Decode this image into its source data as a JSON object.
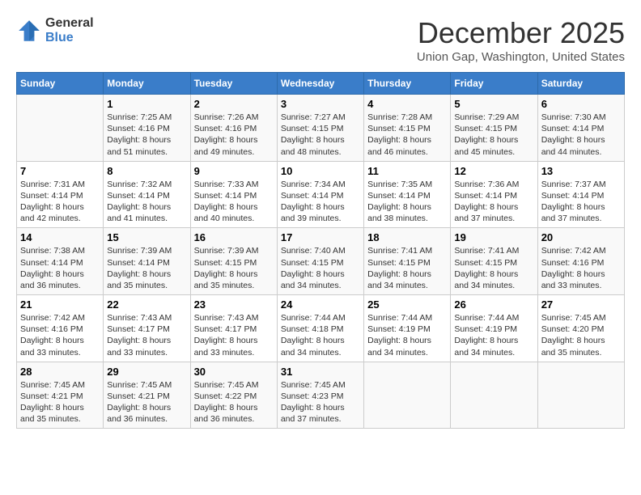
{
  "logo": {
    "general": "General",
    "blue": "Blue"
  },
  "title": "December 2025",
  "location": "Union Gap, Washington, United States",
  "days_of_week": [
    "Sunday",
    "Monday",
    "Tuesday",
    "Wednesday",
    "Thursday",
    "Friday",
    "Saturday"
  ],
  "weeks": [
    [
      {
        "day": "",
        "info": ""
      },
      {
        "day": "1",
        "info": "Sunrise: 7:25 AM\nSunset: 4:16 PM\nDaylight: 8 hours\nand 51 minutes."
      },
      {
        "day": "2",
        "info": "Sunrise: 7:26 AM\nSunset: 4:16 PM\nDaylight: 8 hours\nand 49 minutes."
      },
      {
        "day": "3",
        "info": "Sunrise: 7:27 AM\nSunset: 4:15 PM\nDaylight: 8 hours\nand 48 minutes."
      },
      {
        "day": "4",
        "info": "Sunrise: 7:28 AM\nSunset: 4:15 PM\nDaylight: 8 hours\nand 46 minutes."
      },
      {
        "day": "5",
        "info": "Sunrise: 7:29 AM\nSunset: 4:15 PM\nDaylight: 8 hours\nand 45 minutes."
      },
      {
        "day": "6",
        "info": "Sunrise: 7:30 AM\nSunset: 4:14 PM\nDaylight: 8 hours\nand 44 minutes."
      }
    ],
    [
      {
        "day": "7",
        "info": "Sunrise: 7:31 AM\nSunset: 4:14 PM\nDaylight: 8 hours\nand 42 minutes."
      },
      {
        "day": "8",
        "info": "Sunrise: 7:32 AM\nSunset: 4:14 PM\nDaylight: 8 hours\nand 41 minutes."
      },
      {
        "day": "9",
        "info": "Sunrise: 7:33 AM\nSunset: 4:14 PM\nDaylight: 8 hours\nand 40 minutes."
      },
      {
        "day": "10",
        "info": "Sunrise: 7:34 AM\nSunset: 4:14 PM\nDaylight: 8 hours\nand 39 minutes."
      },
      {
        "day": "11",
        "info": "Sunrise: 7:35 AM\nSunset: 4:14 PM\nDaylight: 8 hours\nand 38 minutes."
      },
      {
        "day": "12",
        "info": "Sunrise: 7:36 AM\nSunset: 4:14 PM\nDaylight: 8 hours\nand 37 minutes."
      },
      {
        "day": "13",
        "info": "Sunrise: 7:37 AM\nSunset: 4:14 PM\nDaylight: 8 hours\nand 37 minutes."
      }
    ],
    [
      {
        "day": "14",
        "info": "Sunrise: 7:38 AM\nSunset: 4:14 PM\nDaylight: 8 hours\nand 36 minutes."
      },
      {
        "day": "15",
        "info": "Sunrise: 7:39 AM\nSunset: 4:14 PM\nDaylight: 8 hours\nand 35 minutes."
      },
      {
        "day": "16",
        "info": "Sunrise: 7:39 AM\nSunset: 4:15 PM\nDaylight: 8 hours\nand 35 minutes."
      },
      {
        "day": "17",
        "info": "Sunrise: 7:40 AM\nSunset: 4:15 PM\nDaylight: 8 hours\nand 34 minutes."
      },
      {
        "day": "18",
        "info": "Sunrise: 7:41 AM\nSunset: 4:15 PM\nDaylight: 8 hours\nand 34 minutes."
      },
      {
        "day": "19",
        "info": "Sunrise: 7:41 AM\nSunset: 4:15 PM\nDaylight: 8 hours\nand 34 minutes."
      },
      {
        "day": "20",
        "info": "Sunrise: 7:42 AM\nSunset: 4:16 PM\nDaylight: 8 hours\nand 33 minutes."
      }
    ],
    [
      {
        "day": "21",
        "info": "Sunrise: 7:42 AM\nSunset: 4:16 PM\nDaylight: 8 hours\nand 33 minutes."
      },
      {
        "day": "22",
        "info": "Sunrise: 7:43 AM\nSunset: 4:17 PM\nDaylight: 8 hours\nand 33 minutes."
      },
      {
        "day": "23",
        "info": "Sunrise: 7:43 AM\nSunset: 4:17 PM\nDaylight: 8 hours\nand 33 minutes."
      },
      {
        "day": "24",
        "info": "Sunrise: 7:44 AM\nSunset: 4:18 PM\nDaylight: 8 hours\nand 34 minutes."
      },
      {
        "day": "25",
        "info": "Sunrise: 7:44 AM\nSunset: 4:19 PM\nDaylight: 8 hours\nand 34 minutes."
      },
      {
        "day": "26",
        "info": "Sunrise: 7:44 AM\nSunset: 4:19 PM\nDaylight: 8 hours\nand 34 minutes."
      },
      {
        "day": "27",
        "info": "Sunrise: 7:45 AM\nSunset: 4:20 PM\nDaylight: 8 hours\nand 35 minutes."
      }
    ],
    [
      {
        "day": "28",
        "info": "Sunrise: 7:45 AM\nSunset: 4:21 PM\nDaylight: 8 hours\nand 35 minutes."
      },
      {
        "day": "29",
        "info": "Sunrise: 7:45 AM\nSunset: 4:21 PM\nDaylight: 8 hours\nand 36 minutes."
      },
      {
        "day": "30",
        "info": "Sunrise: 7:45 AM\nSunset: 4:22 PM\nDaylight: 8 hours\nand 36 minutes."
      },
      {
        "day": "31",
        "info": "Sunrise: 7:45 AM\nSunset: 4:23 PM\nDaylight: 8 hours\nand 37 minutes."
      },
      {
        "day": "",
        "info": ""
      },
      {
        "day": "",
        "info": ""
      },
      {
        "day": "",
        "info": ""
      }
    ]
  ]
}
